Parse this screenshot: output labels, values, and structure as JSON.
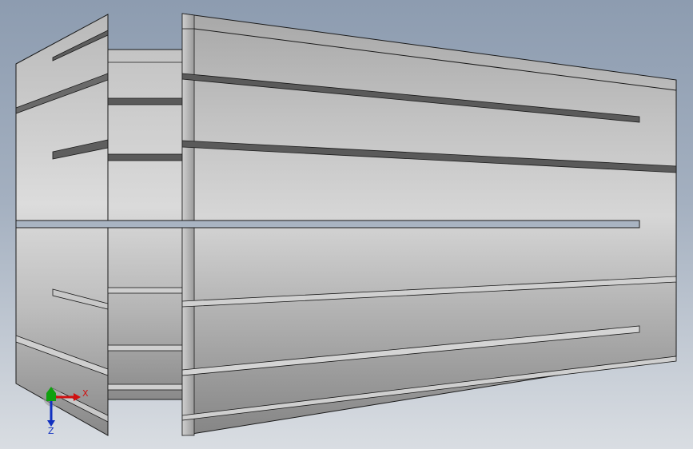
{
  "viewport": {
    "background_top": "#8d9cb0",
    "background_bottom": "#d9dde2",
    "model": "collet-3d-model",
    "view_mode": "shaded-with-edges"
  },
  "triad": {
    "x_label": "X",
    "y_label": "",
    "z_label": "Z",
    "x_color": "#d01010",
    "y_color": "#10a010",
    "z_color": "#1030c0"
  },
  "colors": {
    "body_light": "#dcdcdc",
    "body_mid": "#b4b4b4",
    "body_dark": "#8c8c8c",
    "slot": "#5a5a5a",
    "edge": "#1a1a1a"
  }
}
